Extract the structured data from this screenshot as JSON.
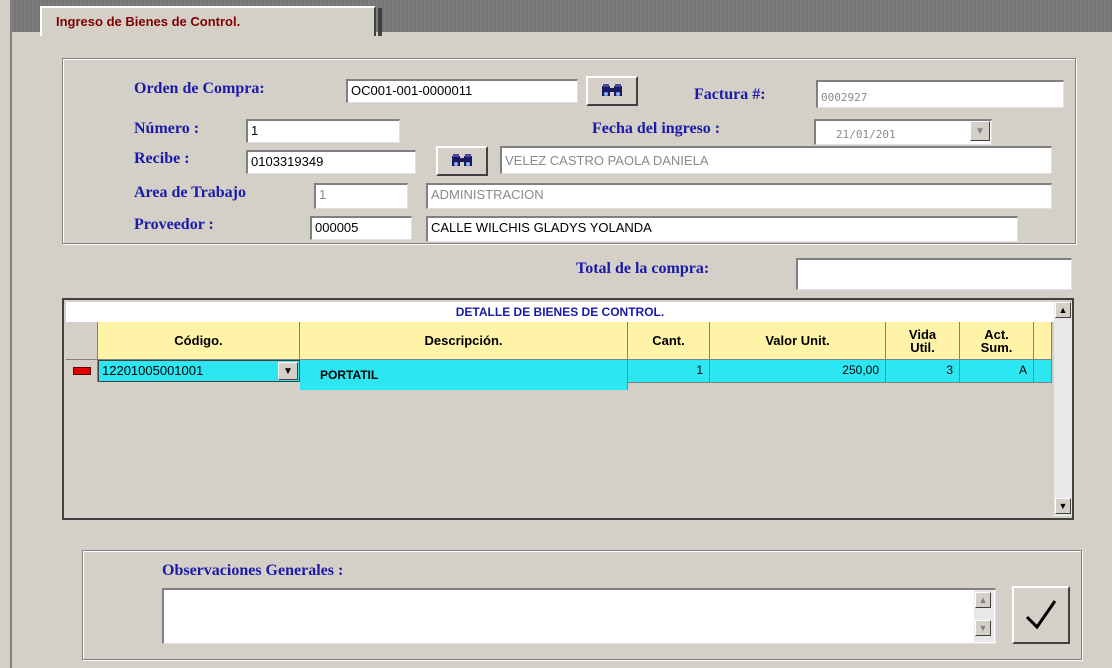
{
  "tab": {
    "label": "Ingreso de Bienes de Control."
  },
  "header": {
    "orden_compra_label": "Orden de Compra:",
    "orden_compra_value": "OC001-001-0000011",
    "factura_label": "Factura #:",
    "factura_value": "0002927",
    "numero_label": "Número :",
    "numero_value": "1",
    "fecha_label": "Fecha del ingreso :",
    "fecha_value": "21/01/201",
    "recibe_label": "Recibe :",
    "recibe_code": "0103319349",
    "recibe_name": "VELEZ CASTRO PAOLA DANIELA",
    "area_label": "Area de Trabajo",
    "area_code": "1",
    "area_name": "ADMINISTRACION",
    "proveedor_label": "Proveedor :",
    "proveedor_code": "000005",
    "proveedor_name": "CALLE WILCHIS GLADYS YOLANDA",
    "total_label": "Total de la compra:",
    "total_value": ""
  },
  "grid": {
    "title": "DETALLE DE BIENES DE CONTROL.",
    "columns": [
      "Código.",
      "Descripción.",
      "Cant.",
      "Valor Unit.",
      "Vida Util.",
      "Act. Sum."
    ],
    "rows": [
      {
        "codigo": "12201005001001",
        "descripcion": "PORTATIL",
        "cant": "1",
        "valor": "250,00",
        "vida": "3",
        "act": "A"
      }
    ]
  },
  "observaciones": {
    "label": "Observaciones Generales :",
    "value": ""
  },
  "colors": {
    "label_blue": "#1a1aa8",
    "tab_text": "#800000",
    "grid_header": "#fff3a8",
    "grid_row": "#2ce6f2"
  },
  "icons": {
    "search": "binoculars-icon",
    "confirm": "checkmark-icon"
  }
}
